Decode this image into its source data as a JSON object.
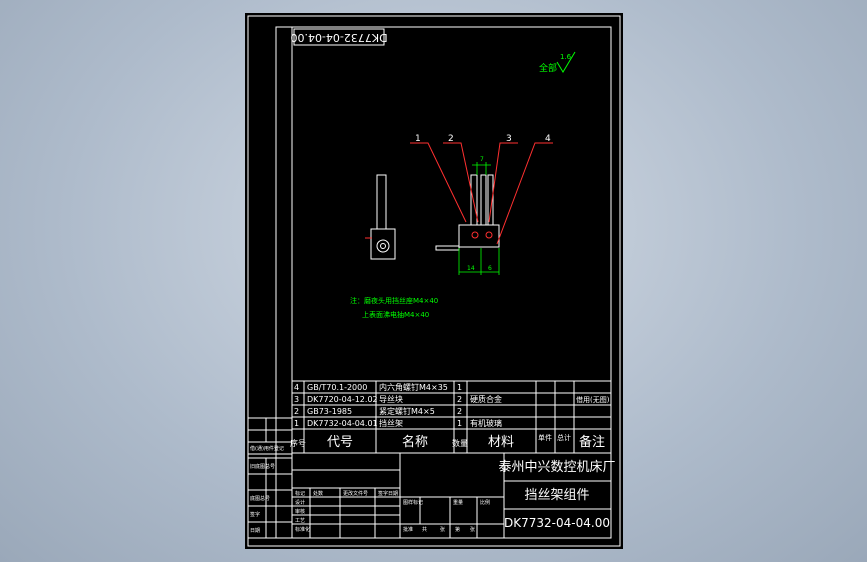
{
  "drawing": {
    "code_stamp": "DK7732-04-04.00",
    "roughness": {
      "label": "全部",
      "value": "1.6"
    },
    "balloons": [
      "1",
      "2",
      "3",
      "4"
    ],
    "dims": {
      "top": "7",
      "bottom_left": "14",
      "bottom_right": "6"
    },
    "notes": [
      "注：磨夜头用挡丝座M4×40",
      "上表面沸电抽M4×40"
    ]
  },
  "bom": {
    "headers": {
      "index": "序号",
      "code": "代号",
      "name": "名称",
      "qty": "数量",
      "material": "材料",
      "unit_weight": "单件",
      "total_weight": "总计",
      "remark": "备注"
    },
    "rows": [
      {
        "index": "4",
        "code": "GB/T70.1-2000",
        "name": "内六角螺钉M4×35",
        "qty": "1",
        "material": "",
        "remark": ""
      },
      {
        "index": "3",
        "code": "DK7720-04-12.02",
        "name": "导丝块",
        "qty": "2",
        "material": "硬质合金",
        "remark": "借用(无图)"
      },
      {
        "index": "2",
        "code": "GB73-1985",
        "name": "紧定螺钉M4×5",
        "qty": "2",
        "material": "",
        "remark": ""
      },
      {
        "index": "1",
        "code": "DK7732-04-04.01",
        "name": "挡丝架",
        "qty": "1",
        "material": "有机玻璃",
        "remark": ""
      }
    ]
  },
  "title_block": {
    "company": "泰州中兴数控机床厂",
    "part_name": "挡丝架组件",
    "drawing_no": "DK7732-04-04.00",
    "left_labels": [
      "借(通)用件登记",
      "旧底图总号",
      "底图总号",
      "签字",
      "日期"
    ],
    "sign_labels": [
      "标记",
      "处数",
      "更改文件号",
      "签字",
      "日期"
    ],
    "role_labels": [
      "设计",
      "审核",
      "工艺",
      "标准化",
      "批准"
    ],
    "stage_labels": [
      "图样标记",
      "重量",
      "比例"
    ],
    "sheet_labels": [
      "共",
      "张",
      "第",
      "张"
    ]
  }
}
